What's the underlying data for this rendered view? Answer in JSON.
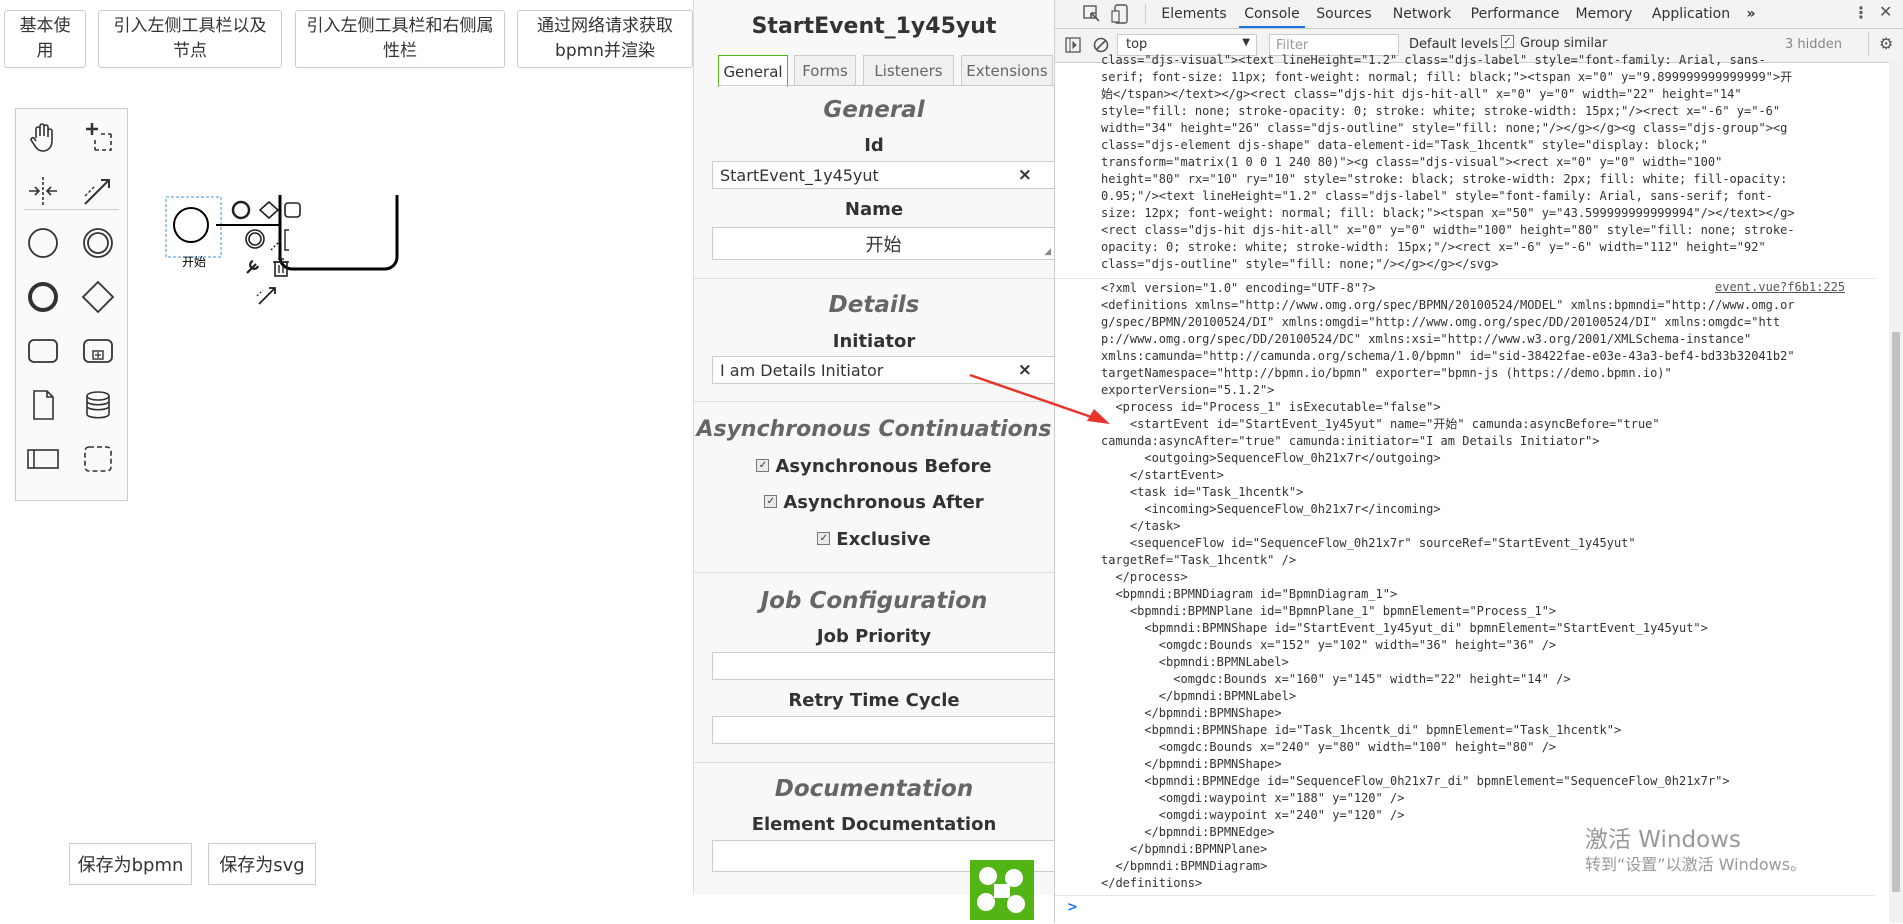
{
  "top_buttons": [
    "基本使用",
    "引入左侧工具栏以及节点",
    "引入左侧工具栏和右侧属性栏",
    "通过网络请求获取bpmn并渲染"
  ],
  "canvas": {
    "start_event_label": "开始"
  },
  "bottom_buttons": {
    "save_bpmn": "保存为bpmn",
    "save_svg": "保存为svg"
  },
  "props": {
    "title": "StartEvent_1y45yut",
    "tabs": [
      "General",
      "Forms",
      "Listeners",
      "Extensions"
    ],
    "general": {
      "heading": "General",
      "id_label": "Id",
      "id_value": "StartEvent_1y45yut",
      "name_label": "Name",
      "name_value": "开始"
    },
    "details": {
      "heading": "Details",
      "initiator_label": "Initiator",
      "initiator_value": "I am Details Initiator"
    },
    "async": {
      "heading": "Asynchronous Continuations",
      "before": "Asynchronous Before",
      "after": "Asynchronous After",
      "exclusive": "Exclusive"
    },
    "job": {
      "heading": "Job Configuration",
      "priority_label": "Job Priority",
      "retry_label": "Retry Time Cycle"
    },
    "doc": {
      "heading": "Documentation",
      "element_label": "Element Documentation"
    },
    "clear_symbol": "×"
  },
  "devtools": {
    "tabs": [
      "Elements",
      "Console",
      "Sources",
      "Network",
      "Performance",
      "Memory",
      "Application"
    ],
    "more": "»",
    "context": "top",
    "filter_placeholder": "Filter",
    "levels": "Default levels",
    "group_similar": "Group similar",
    "hidden": "3 hidden",
    "source_link": "event.vue?f6b1:225",
    "prompt": ">",
    "svg_lines": [
      "class=\"djs-visual\"><text lineHeight=\"1.2\" class=\"djs-label\" style=\"font-family: Arial, sans-",
      "serif; font-size: 11px; font-weight: normal; fill: black;\"><tspan x=\"0\" y=\"9.899999999999999\">开",
      "始</tspan></text></g><rect class=\"djs-hit djs-hit-all\" x=\"0\" y=\"0\" width=\"22\" height=\"14\"",
      "style=\"fill: none; stroke-opacity: 0; stroke: white; stroke-width: 15px;\"/><rect x=\"-6\" y=\"-6\"",
      "width=\"34\" height=\"26\" class=\"djs-outline\" style=\"fill: none;\"/></g></g><g class=\"djs-group\"><g",
      "class=\"djs-element djs-shape\" data-element-id=\"Task_1hcentk\" style=\"display: block;\"",
      "transform=\"matrix(1 0 0 1 240 80)\"><g class=\"djs-visual\"><rect x=\"0\" y=\"0\" width=\"100\"",
      "height=\"80\" rx=\"10\" ry=\"10\" style=\"stroke: black; stroke-width: 2px; fill: white; fill-opacity:",
      "0.95;\"/><text lineHeight=\"1.2\" class=\"djs-label\" style=\"font-family: Arial, sans-serif; font-",
      "size: 12px; font-weight: normal; fill: black;\"><tspan x=\"50\" y=\"43.599999999999994\"/></text></g>",
      "<rect class=\"djs-hit djs-hit-all\" x=\"0\" y=\"0\" width=\"100\" height=\"80\" style=\"fill: none; stroke-",
      "opacity: 0; stroke: white; stroke-width: 15px;\"/><rect x=\"-6\" y=\"-6\" width=\"112\" height=\"92\"",
      "class=\"djs-outline\" style=\"fill: none;\"/></g></g></svg>"
    ],
    "xml_lines": [
      "<?xml version=\"1.0\" encoding=\"UTF-8\"?>",
      "<definitions xmlns=\"http://www.omg.org/spec/BPMN/20100524/MODEL\" xmlns:bpmndi=\"http://www.omg.or",
      "g/spec/BPMN/20100524/DI\" xmlns:omgdi=\"http://www.omg.org/spec/DD/20100524/DI\" xmlns:omgdc=\"htt",
      "p://www.omg.org/spec/DD/20100524/DC\" xmlns:xsi=\"http://www.w3.org/2001/XMLSchema-instance\"",
      "xmlns:camunda=\"http://camunda.org/schema/1.0/bpmn\" id=\"sid-38422fae-e03e-43a3-bef4-bd33b32041b2\"",
      "targetNamespace=\"http://bpmn.io/bpmn\" exporter=\"bpmn-js (https://demo.bpmn.io)\"",
      "exporterVersion=\"5.1.2\">",
      "  <process id=\"Process_1\" isExecutable=\"false\">",
      "    <startEvent id=\"StartEvent_1y45yut\" name=\"开始\" camunda:asyncBefore=\"true\"",
      "camunda:asyncAfter=\"true\" camunda:initiator=\"I am Details Initiator\">",
      "      <outgoing>SequenceFlow_0h21x7r</outgoing>",
      "    </startEvent>",
      "    <task id=\"Task_1hcentk\">",
      "      <incoming>SequenceFlow_0h21x7r</incoming>",
      "    </task>",
      "    <sequenceFlow id=\"SequenceFlow_0h21x7r\" sourceRef=\"StartEvent_1y45yut\"",
      "targetRef=\"Task_1hcentk\" />",
      "  </process>",
      "  <bpmndi:BPMNDiagram id=\"BpmnDiagram_1\">",
      "    <bpmndi:BPMNPlane id=\"BpmnPlane_1\" bpmnElement=\"Process_1\">",
      "      <bpmndi:BPMNShape id=\"StartEvent_1y45yut_di\" bpmnElement=\"StartEvent_1y45yut\">",
      "        <omgdc:Bounds x=\"152\" y=\"102\" width=\"36\" height=\"36\" />",
      "        <bpmndi:BPMNLabel>",
      "          <omgdc:Bounds x=\"160\" y=\"145\" width=\"22\" height=\"14\" />",
      "        </bpmndi:BPMNLabel>",
      "      </bpmndi:BPMNShape>",
      "      <bpmndi:BPMNShape id=\"Task_1hcentk_di\" bpmnElement=\"Task_1hcentk\">",
      "        <omgdc:Bounds x=\"240\" y=\"80\" width=\"100\" height=\"80\" />",
      "      </bpmndi:BPMNShape>",
      "      <bpmndi:BPMNEdge id=\"SequenceFlow_0h21x7r_di\" bpmnElement=\"SequenceFlow_0h21x7r\">",
      "        <omgdi:waypoint x=\"188\" y=\"120\" />",
      "        <omgdi:waypoint x=\"240\" y=\"120\" />",
      "      </bpmndi:BPMNEdge>",
      "    </bpmndi:BPMNPlane>",
      "  </bpmndi:BPMNDiagram>",
      "</definitions>"
    ]
  },
  "watermark": {
    "line1": "激活 Windows",
    "line2": "转到“设置”以激活 Windows。"
  },
  "colors": {
    "arrow": "#e8322c",
    "tab_active": "#1a73e8",
    "props_tab_border": "#52b415"
  }
}
